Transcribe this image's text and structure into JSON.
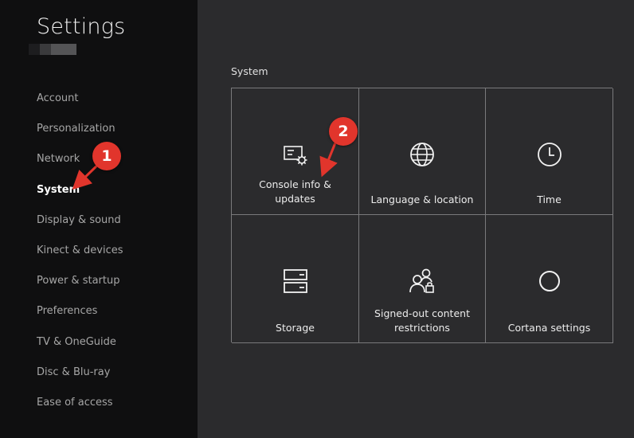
{
  "sidebar": {
    "title": "Settings",
    "items": [
      {
        "label": "Account"
      },
      {
        "label": "Personalization"
      },
      {
        "label": "Network"
      },
      {
        "label": "System"
      },
      {
        "label": "Display & sound"
      },
      {
        "label": "Kinect & devices"
      },
      {
        "label": "Power & startup"
      },
      {
        "label": "Preferences"
      },
      {
        "label": "TV & OneGuide"
      },
      {
        "label": "Disc & Blu-ray"
      },
      {
        "label": "Ease of access"
      }
    ]
  },
  "main": {
    "section_label": "System",
    "tiles": [
      {
        "label": "Console info & updates",
        "icon": "console-info-icon"
      },
      {
        "label": "Language & location",
        "icon": "globe-icon"
      },
      {
        "label": "Time",
        "icon": "clock-icon"
      },
      {
        "label": "Storage",
        "icon": "storage-icon"
      },
      {
        "label": "Signed-out content restrictions",
        "icon": "users-lock-icon"
      },
      {
        "label": "Cortana settings",
        "icon": "cortana-circle-icon"
      }
    ]
  },
  "annotations": {
    "badge_1": "1",
    "badge_2": "2",
    "badge_color": "#e1352c"
  }
}
